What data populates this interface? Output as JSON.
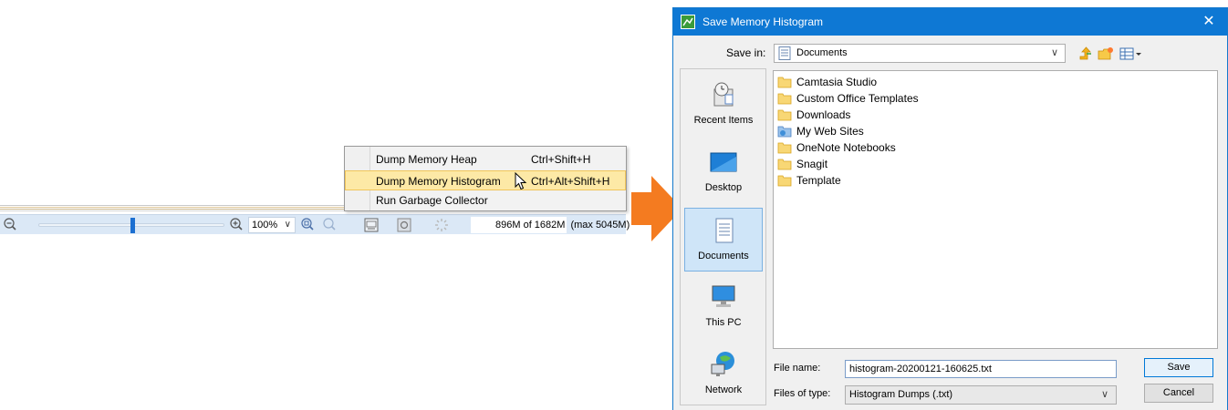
{
  "statusbar": {
    "zoom_level": "100%",
    "memory_used": "896M of 1682M",
    "memory_max": "(max 5045M)",
    "icons": [
      "zoom-out-icon",
      "zoom-in-icon",
      "zoom-fit-icon",
      "zoom-actual-icon",
      "memory-monitor-icon",
      "garbage-collector-icon",
      "progress-spinner-icon"
    ]
  },
  "context_menu": {
    "items": [
      {
        "label": "Dump Memory Heap",
        "shortcut": "Ctrl+Shift+H"
      },
      {
        "label": "Dump Memory Histogram",
        "shortcut": "Ctrl+Alt+Shift+H"
      },
      {
        "label": "Run Garbage Collector",
        "shortcut": ""
      }
    ],
    "highlighted_index": 1
  },
  "dialog": {
    "title": "Save Memory Histogram",
    "save_in_label": "Save in:",
    "save_in_value": "Documents",
    "places": [
      {
        "label": "Recent Items",
        "icon": "recent-items-icon"
      },
      {
        "label": "Desktop",
        "icon": "desktop-icon"
      },
      {
        "label": "Documents",
        "icon": "documents-icon"
      },
      {
        "label": "This PC",
        "icon": "computer-icon"
      },
      {
        "label": "Network",
        "icon": "network-icon"
      }
    ],
    "selected_place": "Documents",
    "files": [
      {
        "name": "Camtasia Studio",
        "icon": "folder-icon"
      },
      {
        "name": "Custom Office Templates",
        "icon": "folder-icon"
      },
      {
        "name": "Downloads",
        "icon": "folder-icon"
      },
      {
        "name": "My Web Sites",
        "icon": "web-folder-icon"
      },
      {
        "name": "OneNote Notebooks",
        "icon": "folder-icon"
      },
      {
        "name": "Snagit",
        "icon": "folder-icon"
      },
      {
        "name": "Template",
        "icon": "folder-icon"
      }
    ],
    "file_name_label": "File name:",
    "file_name_value": "histogram-20200121-160625.txt",
    "file_type_label": "Files of type:",
    "file_type_value": "Histogram Dumps (.txt)",
    "save_button": "Save",
    "cancel_button": "Cancel"
  },
  "colors": {
    "titlebar": "#0e78d4",
    "menu_highlight": "#fde9a6",
    "arrow": "#f47b20",
    "statusbar": "#dbe8f6"
  }
}
